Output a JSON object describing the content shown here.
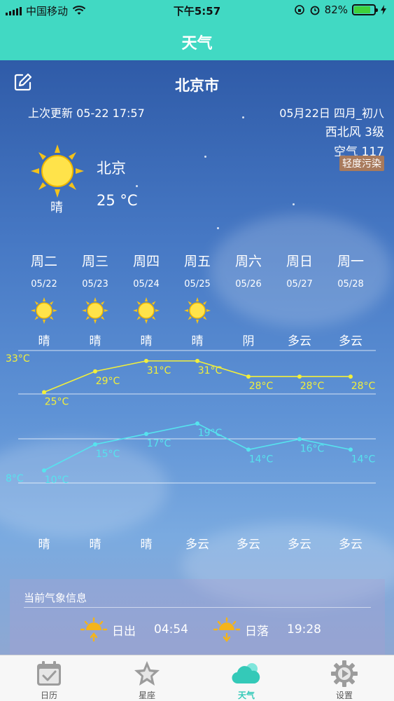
{
  "status_bar": {
    "carrier": "中国移动",
    "time": "下午5:57",
    "battery": "82%",
    "battery_level": 0.82
  },
  "header": {
    "title": "天气"
  },
  "city": {
    "name": "北京市"
  },
  "update": {
    "text": "上次更新 05-22 17:57"
  },
  "date_lunar": "05月22日  四月_初八",
  "wind": "西北风  3级",
  "air": {
    "label": "空气 117",
    "level": "轻度污染"
  },
  "current": {
    "condition": "晴",
    "city": "北京",
    "temp": "25 °C"
  },
  "forecast": [
    {
      "weekday": "周二",
      "date": "05/22",
      "icon": "sun-icon",
      "day_cond": "晴",
      "night_cond": "晴"
    },
    {
      "weekday": "周三",
      "date": "05/23",
      "icon": "sun-icon",
      "day_cond": "晴",
      "night_cond": "晴"
    },
    {
      "weekday": "周四",
      "date": "05/24",
      "icon": "sun-icon",
      "day_cond": "晴",
      "night_cond": "晴"
    },
    {
      "weekday": "周五",
      "date": "05/25",
      "icon": "sun-icon",
      "day_cond": "晴",
      "night_cond": "多云"
    },
    {
      "weekday": "周六",
      "date": "05/26",
      "icon": "none",
      "day_cond": "阴",
      "night_cond": "多云"
    },
    {
      "weekday": "周日",
      "date": "05/27",
      "icon": "none",
      "day_cond": "多云",
      "night_cond": "多云"
    },
    {
      "weekday": "周一",
      "date": "05/28",
      "icon": "none",
      "day_cond": "多云",
      "night_cond": "多云"
    }
  ],
  "chart_data": {
    "type": "line",
    "categories": [
      "周二",
      "周三",
      "周四",
      "周五",
      "周六",
      "周日",
      "周一"
    ],
    "series": [
      {
        "values": [
          25,
          29,
          31,
          31,
          28,
          28,
          28
        ],
        "labels": [
          "25°C",
          "29°C",
          "31°C",
          "31°C",
          "28°C",
          "28°C",
          "28°C"
        ],
        "color": "#f2ef3a"
      },
      {
        "values": [
          10,
          15,
          17,
          19,
          14,
          16,
          14
        ],
        "labels": [
          "10°C",
          "15°C",
          "17°C",
          "19°C",
          "14°C",
          "16°C",
          "14°C"
        ],
        "color": "#56e3ee"
      }
    ],
    "max_label": "33°C",
    "min_label": "8°C",
    "ylim": [
      8,
      33
    ],
    "grid": true
  },
  "info": {
    "title": "当前气象信息",
    "sunrise_label": "日出",
    "sunrise_time": "04:54",
    "sunset_label": "日落",
    "sunset_time": "19:28"
  },
  "tabs": [
    {
      "label": "日历",
      "icon": "calendar-icon",
      "active": false
    },
    {
      "label": "星座",
      "icon": "star-icon",
      "active": false
    },
    {
      "label": "天气",
      "icon": "cloud-icon",
      "active": true
    },
    {
      "label": "设置",
      "icon": "gear-icon",
      "active": false
    }
  ]
}
